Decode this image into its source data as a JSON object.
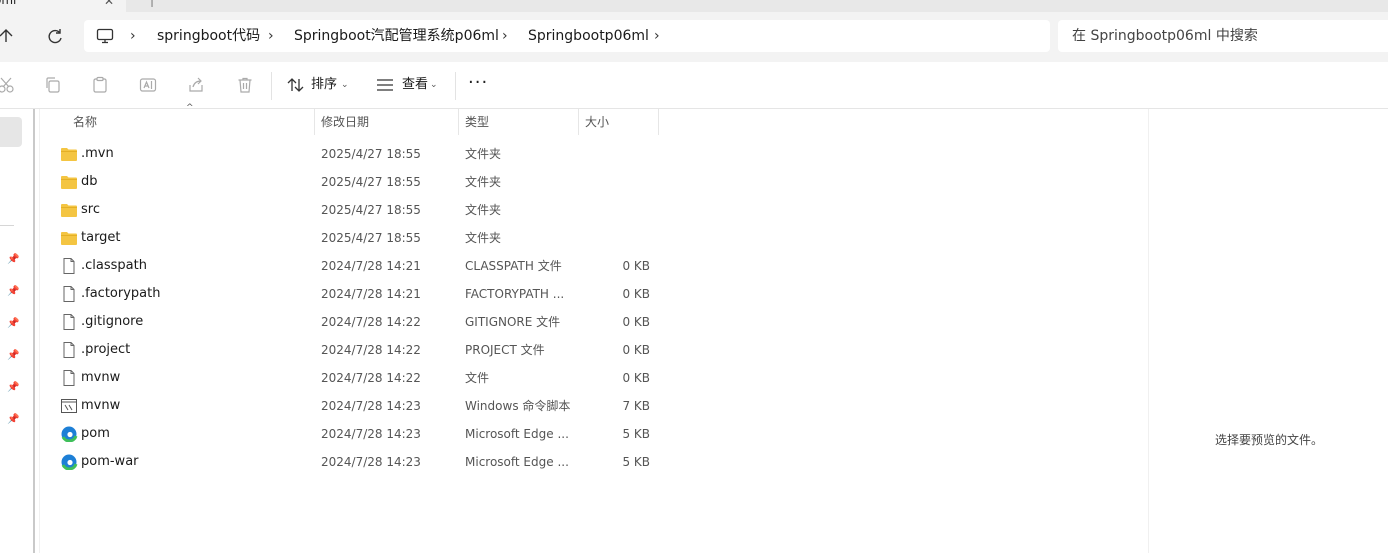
{
  "window": {
    "tab_title": "oml"
  },
  "address_bar": {
    "breadcrumbs": [
      "springboot代码",
      "Springboot汽配管理系统p06ml",
      "Springbootp06ml"
    ],
    "search_placeholder": "在 Springbootp06ml 中搜索"
  },
  "toolbar": {
    "icons": [
      "cut-icon",
      "copy-icon",
      "paste-icon",
      "rename-icon",
      "share-icon",
      "delete-icon"
    ],
    "sort_label": "排序",
    "view_label": "查看",
    "more_label": "···"
  },
  "columns": {
    "name": "名称",
    "modified": "修改日期",
    "type": "类型",
    "size": "大小"
  },
  "files": [
    {
      "name": ".mvn",
      "modified": "2025/4/27 18:55",
      "type": "文件夹",
      "size": "",
      "icon": "folder-icon"
    },
    {
      "name": "db",
      "modified": "2025/4/27 18:55",
      "type": "文件夹",
      "size": "",
      "icon": "folder-icon"
    },
    {
      "name": "src",
      "modified": "2025/4/27 18:55",
      "type": "文件夹",
      "size": "",
      "icon": "folder-icon"
    },
    {
      "name": "target",
      "modified": "2025/4/27 18:55",
      "type": "文件夹",
      "size": "",
      "icon": "folder-icon"
    },
    {
      "name": ".classpath",
      "modified": "2024/7/28 14:21",
      "type": "CLASSPATH 文件",
      "size": "0 KB",
      "icon": "file-icon"
    },
    {
      "name": ".factorypath",
      "modified": "2024/7/28 14:21",
      "type": "FACTORYPATH ...",
      "size": "0 KB",
      "icon": "file-icon"
    },
    {
      "name": ".gitignore",
      "modified": "2024/7/28 14:22",
      "type": "GITIGNORE 文件",
      "size": "0 KB",
      "icon": "file-icon"
    },
    {
      "name": ".project",
      "modified": "2024/7/28 14:22",
      "type": "PROJECT 文件",
      "size": "0 KB",
      "icon": "file-icon"
    },
    {
      "name": "mvnw",
      "modified": "2024/7/28 14:22",
      "type": "文件",
      "size": "0 KB",
      "icon": "file-icon"
    },
    {
      "name": "mvnw",
      "modified": "2024/7/28 14:23",
      "type": "Windows 命令脚本",
      "size": "7 KB",
      "icon": "script-icon"
    },
    {
      "name": "pom",
      "modified": "2024/7/28 14:23",
      "type": "Microsoft Edge ...",
      "size": "5 KB",
      "icon": "edge-icon"
    },
    {
      "name": "pom-war",
      "modified": "2024/7/28 14:23",
      "type": "Microsoft Edge ...",
      "size": "5 KB",
      "icon": "edge-icon"
    }
  ],
  "preview_pane": {
    "message": "选择要预览的文件。"
  },
  "colors": {
    "folder": "#f4c542",
    "edge_blue": "#1d7fd6",
    "edge_green": "#3fbf5a",
    "chrome_bg": "#f3f3f3"
  }
}
